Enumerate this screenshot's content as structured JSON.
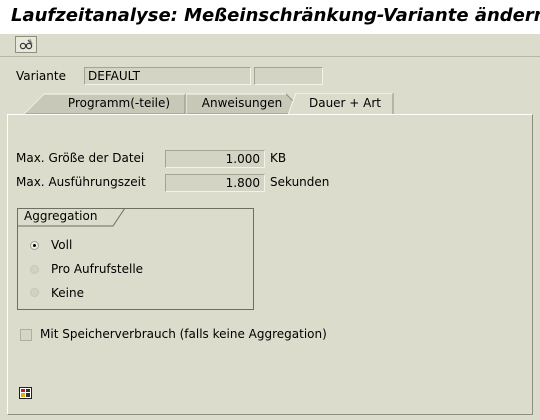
{
  "window": {
    "title": "Laufzeitanalyse: Meßeinschränkung-Variante ändern"
  },
  "toolbar": {
    "button_icon": "glasses-icon"
  },
  "variante": {
    "label": "Variante",
    "value": "DEFAULT",
    "extra_value": ""
  },
  "tabs": [
    {
      "label": "Programm(-teile)",
      "active": false
    },
    {
      "label": "Anweisungen",
      "active": false
    },
    {
      "label": "Dauer + Art",
      "active": true
    }
  ],
  "limits": {
    "size_label": "Max. Größe der Datei",
    "size_value": "1.000",
    "size_unit": "KB",
    "time_label": "Max. Ausführungszeit",
    "time_value": "1.800",
    "time_unit": "Sekunden"
  },
  "aggregation": {
    "title": "Aggregation",
    "options": [
      {
        "label": "Voll",
        "selected": true
      },
      {
        "label": "Pro Aufrufstelle",
        "selected": false
      },
      {
        "label": "Keine",
        "selected": false
      }
    ]
  },
  "memory": {
    "label": "Mit Speicherverbrauch (falls keine Aggregation)",
    "checked": false
  },
  "footer": {
    "icon": "help-grid-icon"
  },
  "colors": {
    "background": "#dcdccc",
    "field": "#d4d4c4",
    "title_bar": "#ffffff"
  }
}
